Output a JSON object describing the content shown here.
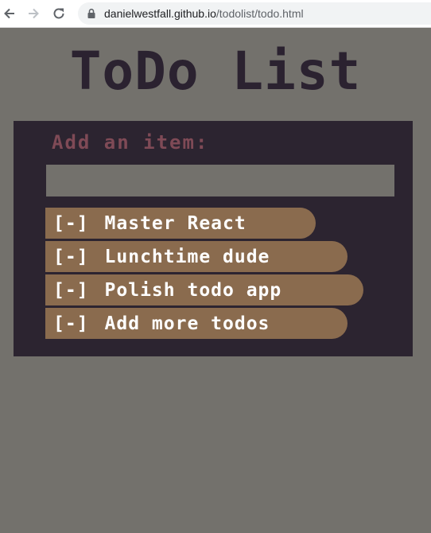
{
  "browser": {
    "url_domain": "danielwestfall.github.io",
    "url_path": "/todolist/todo.html"
  },
  "page": {
    "title": "ToDo List"
  },
  "add_form": {
    "label": "Add an item:",
    "input_value": ""
  },
  "todos": [
    {
      "remove_label": "[-]",
      "text": "Master React"
    },
    {
      "remove_label": "[-]",
      "text": "Lunchtime dude"
    },
    {
      "remove_label": "[-]",
      "text": "Polish todo app"
    },
    {
      "remove_label": "[-]",
      "text": "Add more todos"
    }
  ],
  "colors": {
    "page_background": "#73716c",
    "panel_background": "#2c2430",
    "title": "#2b2230",
    "label": "#7f4a56",
    "item_background": "#8a6b4e",
    "item_text": "#ffffff"
  },
  "icons": {
    "back": "arrow-left-icon",
    "forward": "arrow-right-icon",
    "reload": "reload-icon",
    "lock": "lock-icon"
  }
}
